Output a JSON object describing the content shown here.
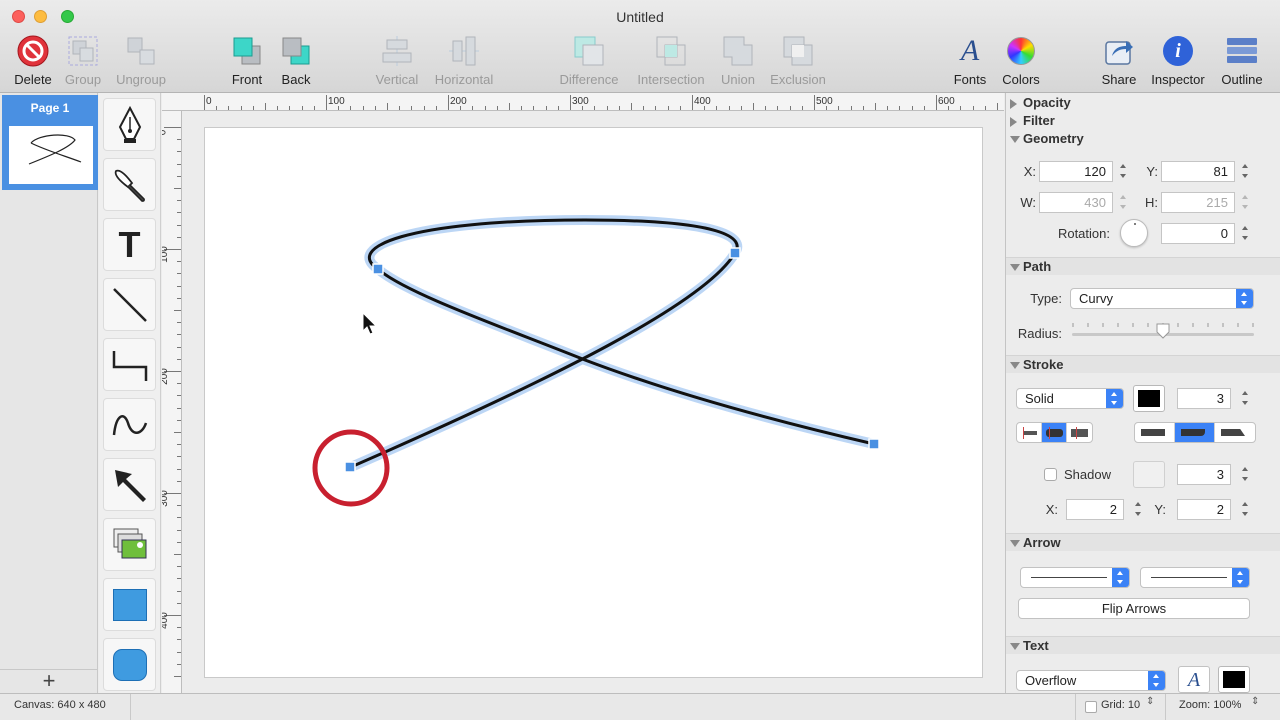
{
  "window": {
    "title": "Untitled"
  },
  "toolbar": {
    "delete": "Delete",
    "group": "Group",
    "ungroup": "Ungroup",
    "front": "Front",
    "back": "Back",
    "vertical": "Vertical",
    "horizontal": "Horizontal",
    "difference": "Difference",
    "intersection": "Intersection",
    "union": "Union",
    "exclusion": "Exclusion",
    "fonts": "Fonts",
    "colors": "Colors",
    "share": "Share",
    "inspector": "Inspector",
    "outline": "Outline"
  },
  "pages": {
    "items": [
      {
        "label": "Page 1"
      }
    ],
    "add": "+"
  },
  "rulers": {
    "horizontal": [
      "0",
      "100",
      "200",
      "300",
      "400",
      "500",
      "600"
    ],
    "vertical": [
      "0",
      "100",
      "200",
      "300",
      "400"
    ]
  },
  "inspector": {
    "opacity": "Opacity",
    "filter": "Filter",
    "geometry": {
      "title": "Geometry",
      "x_label": "X:",
      "x": "120",
      "y_label": "Y:",
      "y": "81",
      "w_label": "W:",
      "w": "430",
      "h_label": "H:",
      "h": "215",
      "rotation_label": "Rotation:",
      "rotation": "0"
    },
    "path": {
      "title": "Path",
      "type_label": "Type:",
      "type": "Curvy",
      "radius_label": "Radius:",
      "radius_level": 0.5
    },
    "stroke": {
      "title": "Stroke",
      "style": "Solid",
      "color": "#000000",
      "width": "3",
      "shadow_label": "Shadow",
      "shadow_checked": false,
      "shadow_size": "3",
      "x_label": "X:",
      "x": "2",
      "y_label": "Y:",
      "y": "2"
    },
    "arrow": {
      "title": "Arrow",
      "flip": "Flip Arrows"
    },
    "text": {
      "title": "Text",
      "overflow": "Overflow",
      "color": "#000000"
    }
  },
  "status": {
    "canvas": "Canvas: 640 x 480",
    "grid": "Grid: 10",
    "zoom": "Zoom: 100%"
  },
  "colors": {
    "accent": "#3b82f6",
    "selection": "#4a90e2",
    "highlight_circle": "#c8202f"
  }
}
